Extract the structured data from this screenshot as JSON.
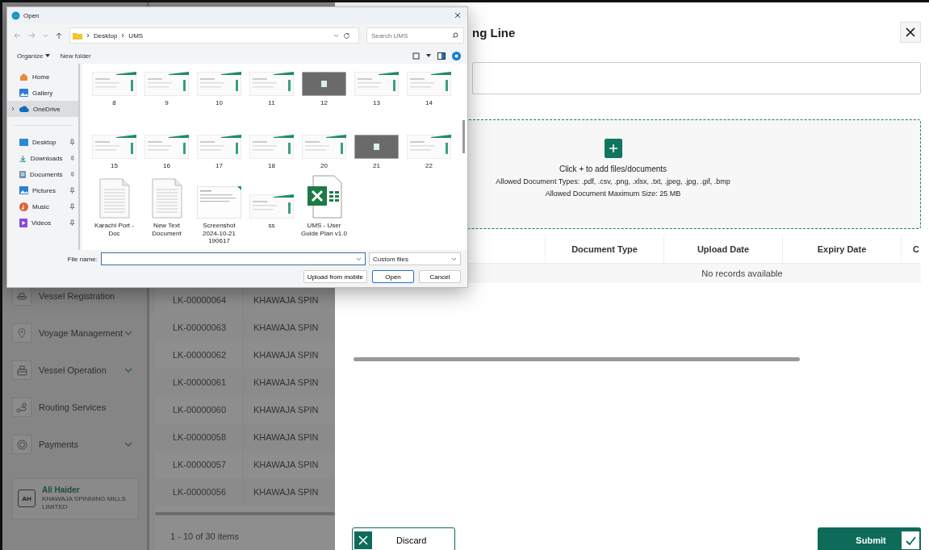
{
  "file_dialog": {
    "title": "Open",
    "path": [
      "Desktop",
      "UMS"
    ],
    "search": {
      "placeholder": "Search UMS"
    },
    "toolbar": {
      "organize": "Organize",
      "new_folder": "New folder"
    },
    "nav_top": [
      {
        "label": "Home",
        "kind": "home",
        "selected": false,
        "expandable": false
      },
      {
        "label": "Gallery",
        "kind": "gallery",
        "selected": false,
        "expandable": false
      },
      {
        "label": "OneDrive",
        "kind": "cloud",
        "selected": true,
        "expandable": true
      }
    ],
    "nav_quick": [
      {
        "label": "Desktop",
        "kind": "desktop",
        "pinned": true
      },
      {
        "label": "Downloads",
        "kind": "downloads",
        "pinned": true
      },
      {
        "label": "Documents",
        "kind": "documents",
        "pinned": true
      },
      {
        "label": "Pictures",
        "kind": "pictures",
        "pinned": true
      },
      {
        "label": "Music",
        "kind": "music",
        "pinned": true
      },
      {
        "label": "Videos",
        "kind": "videos",
        "pinned": true
      }
    ],
    "files": [
      {
        "name": "8",
        "kind": "light"
      },
      {
        "name": "9",
        "kind": "light"
      },
      {
        "name": "10",
        "kind": "light"
      },
      {
        "name": "11",
        "kind": "light"
      },
      {
        "name": "12",
        "kind": "dark"
      },
      {
        "name": "13",
        "kind": "light"
      },
      {
        "name": "14",
        "kind": "light"
      },
      {
        "name": "15",
        "kind": "light"
      },
      {
        "name": "16",
        "kind": "light"
      },
      {
        "name": "17",
        "kind": "light"
      },
      {
        "name": "18",
        "kind": "light"
      },
      {
        "name": "20",
        "kind": "light"
      },
      {
        "name": "21",
        "kind": "dark"
      },
      {
        "name": "22",
        "kind": "light"
      },
      {
        "name": "Karachi Port - Doc",
        "kind": "doc"
      },
      {
        "name": "New Text Document",
        "kind": "doc"
      },
      {
        "name": "Screenshot 2024-10-21 190617",
        "kind": "screenshot"
      },
      {
        "name": "ss",
        "kind": "light"
      },
      {
        "name": "UMS - User Guide Plan v1.0",
        "kind": "excel"
      }
    ],
    "file_name_label": "File name:",
    "file_type": "Custom files",
    "buttons": [
      {
        "label": "Upload from mobile",
        "default": false
      },
      {
        "label": "Open",
        "default": true
      },
      {
        "label": "Cancel",
        "default": false
      }
    ]
  },
  "sidebar": {
    "items": [
      {
        "label": "Vessel Registration",
        "kind": "ship",
        "submenu": false
      },
      {
        "label": "Voyage Management",
        "kind": "location",
        "submenu": true
      },
      {
        "label": "Vessel Operation",
        "kind": "boat",
        "submenu": true
      },
      {
        "label": "Routing Services",
        "kind": "route",
        "submenu": false
      },
      {
        "label": "Payments",
        "kind": "coin",
        "submenu": true
      }
    ],
    "user": {
      "initials": "AH",
      "name": "Ali Haider",
      "company": "KHAWAJA SPINNING MILLS LIMITED"
    }
  },
  "records": {
    "rows": [
      {
        "id": "LK-00000064",
        "company": "KHAWAJA SPIN"
      },
      {
        "id": "LK-00000063",
        "company": "KHAWAJA SPIN"
      },
      {
        "id": "LK-00000062",
        "company": "KHAWAJA SPIN"
      },
      {
        "id": "LK-00000061",
        "company": "KHAWAJA SPIN"
      },
      {
        "id": "LK-00000060",
        "company": "KHAWAJA SPIN"
      },
      {
        "id": "LK-00000058",
        "company": "KHAWAJA SPIN"
      },
      {
        "id": "LK-00000057",
        "company": "KHAWAJA SPIN"
      },
      {
        "id": "LK-00000056",
        "company": "KHAWAJA SPIN"
      }
    ],
    "pager": "1 - 10 of 30 items"
  },
  "panel": {
    "title": "ng Line",
    "upload": {
      "prompt": "Click + to add files/documents",
      "types": "Allowed Document Types: .pdf, .csv, .png, .xlsx, .txt, .jpeg, .jpg, .gif, .bmp",
      "size": "Allowed Document Maximum Size: 25 MB"
    },
    "columns": [
      "Document Type",
      "Upload Date",
      "Expiry Date",
      "C"
    ],
    "empty": "No records available",
    "buttons": [
      {
        "label": "Discard",
        "kind": "secondary"
      },
      {
        "label": "Submit",
        "kind": "primary"
      }
    ]
  }
}
